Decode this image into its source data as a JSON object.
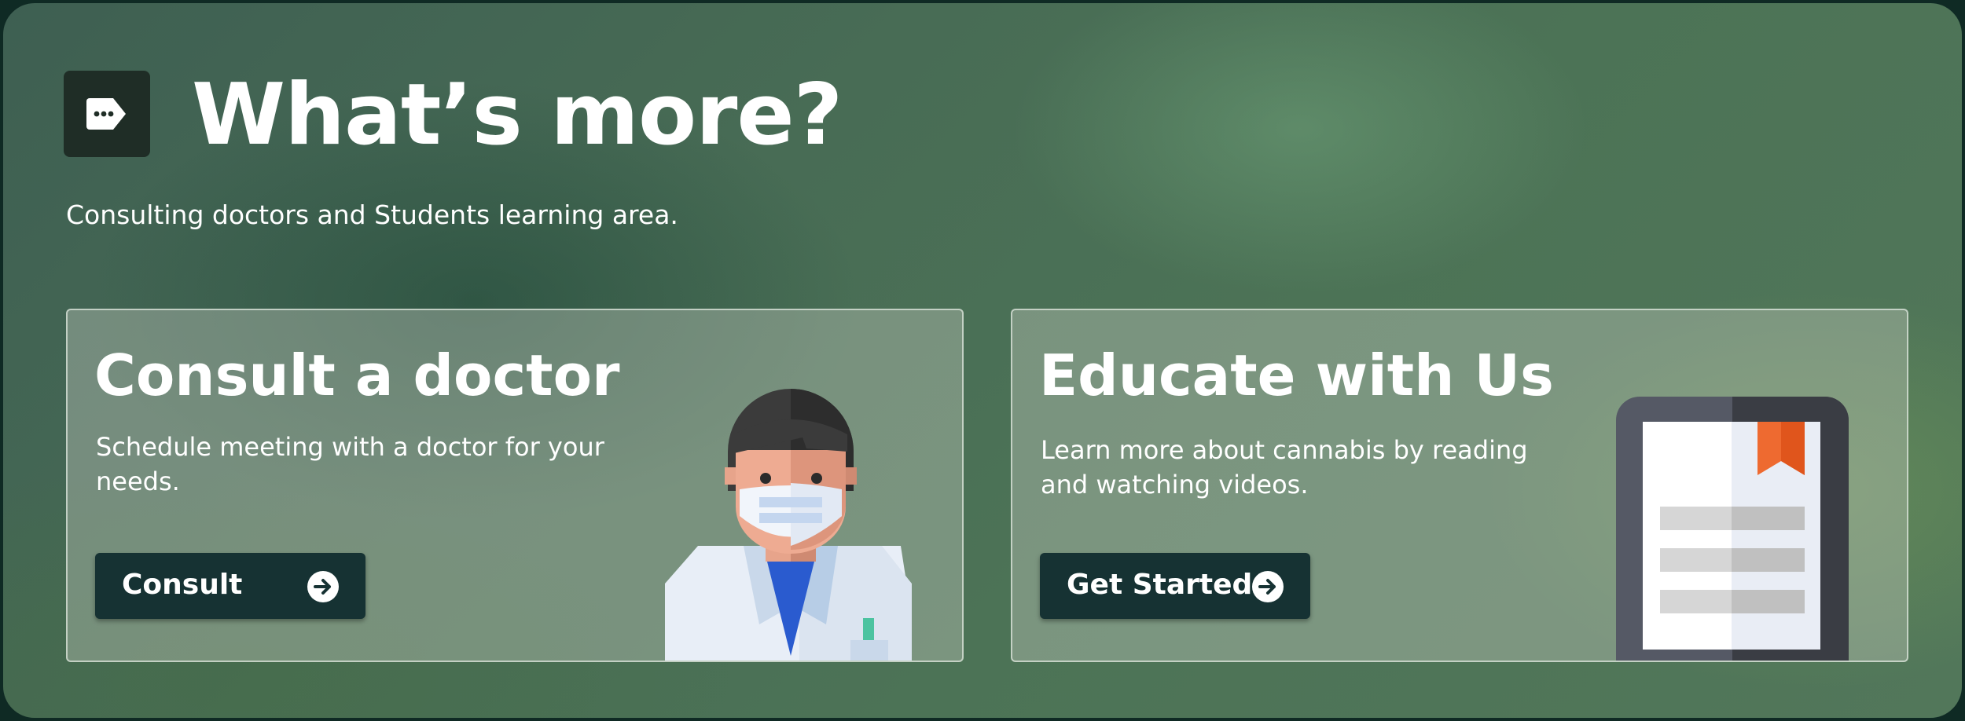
{
  "header": {
    "icon": "tag-icon",
    "title": "What’s more?",
    "subtitle": "Consulting doctors and Students learning area."
  },
  "cards": [
    {
      "title": "Consult a doctor",
      "description": "Schedule meeting with a doctor for your needs.",
      "button_label": "Consult",
      "button_icon": "arrow-right-circle-icon",
      "illustration": "doctor-illustration"
    },
    {
      "title": "Educate with Us",
      "description": "Learn more about cannabis by reading and watching videos.",
      "button_label": "Get Started",
      "button_icon": "arrow-right-circle-icon",
      "illustration": "book-illustration"
    }
  ],
  "colors": {
    "button_bg": "#163233",
    "header_icon_bg": "#1f2d26",
    "accent_bookmark": "#ee6a30"
  }
}
